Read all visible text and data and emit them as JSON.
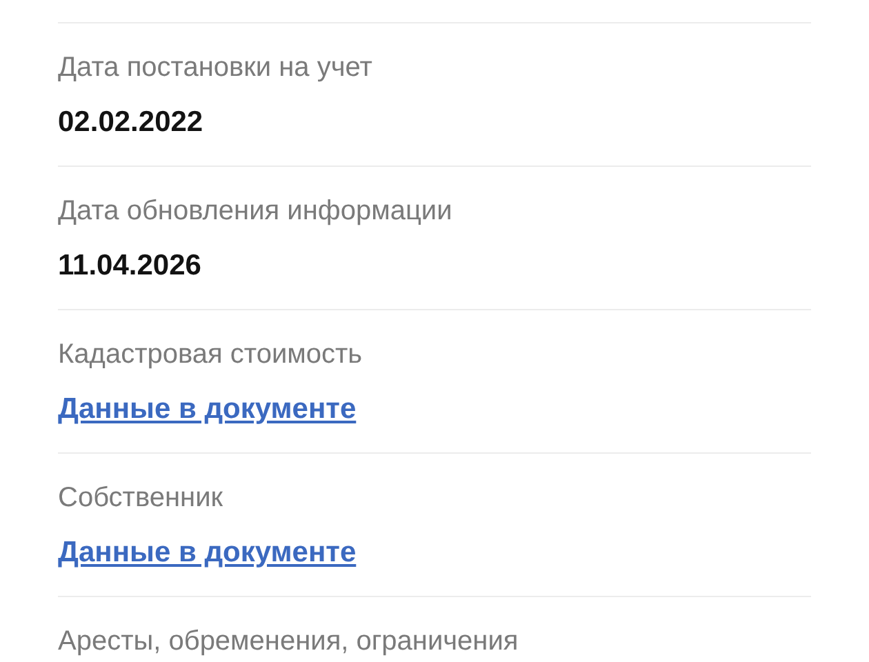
{
  "fields": [
    {
      "label": "Дата постановки на учет",
      "value": {
        "kind": "text",
        "text": "02.02.2022"
      }
    },
    {
      "label": "Дата обновления информации",
      "value": {
        "kind": "text",
        "text": "11.04.2026"
      }
    },
    {
      "label": "Кадастровая стоимость",
      "value": {
        "kind": "link",
        "text": "Данные в документе"
      }
    },
    {
      "label": "Собственник",
      "value": {
        "kind": "link",
        "text": "Данные в документе"
      }
    },
    {
      "label": "Аресты, обременения, ограничения"
    }
  ]
}
